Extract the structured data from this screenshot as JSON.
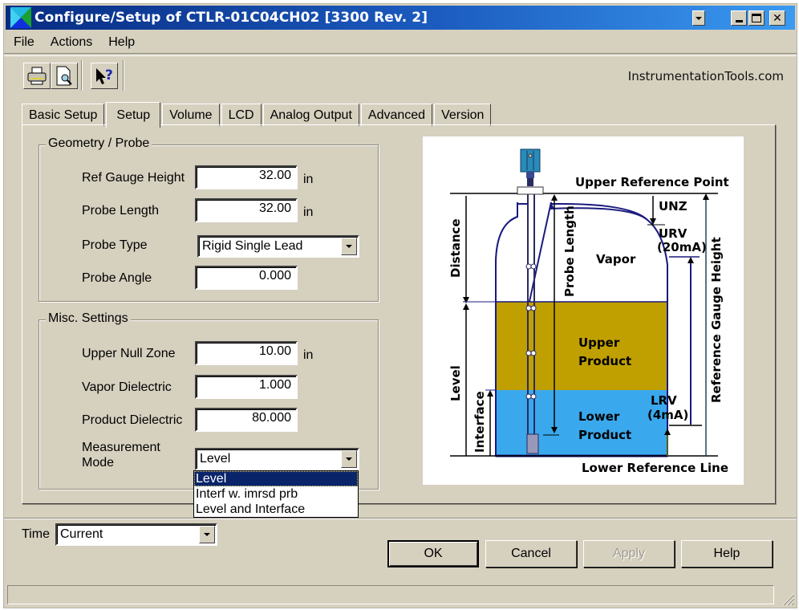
{
  "window": {
    "title": "Configure/Setup of CTLR-01C04CH02 [3300 Rev. 2]",
    "controls": [
      "dropdown",
      "minimize",
      "maximize",
      "close"
    ]
  },
  "menu": {
    "items": [
      {
        "label": "File"
      },
      {
        "label": "Actions"
      },
      {
        "label": "Help"
      }
    ]
  },
  "toolbar": {
    "buttons": [
      {
        "icon": "printer-icon"
      },
      {
        "icon": "print-preview-icon"
      },
      {
        "icon": "context-help-icon"
      }
    ],
    "brand": "InstrumentationTools.com"
  },
  "tabs": [
    {
      "label": "Basic Setup",
      "active": false
    },
    {
      "label": "Setup",
      "active": true
    },
    {
      "label": "Volume",
      "active": false
    },
    {
      "label": "LCD",
      "active": false
    },
    {
      "label": "Analog Output",
      "active": false
    },
    {
      "label": "Advanced",
      "active": false
    },
    {
      "label": "Version",
      "active": false
    }
  ],
  "geometry": {
    "title": "Geometry / Probe",
    "ref_gauge_height": {
      "label": "Ref Gauge Height",
      "value": "32.00",
      "unit": "in"
    },
    "probe_length": {
      "label": "Probe Length",
      "value": "32.00",
      "unit": "in"
    },
    "probe_type": {
      "label": "Probe Type",
      "value": "Rigid Single Lead"
    },
    "probe_angle": {
      "label": "Probe Angle",
      "value": "0.000"
    }
  },
  "misc": {
    "title": "Misc. Settings",
    "upper_null_zone": {
      "label": "Upper Null Zone",
      "value": "10.00",
      "unit": "in"
    },
    "vapor_dielectric": {
      "label": "Vapor Dielectric",
      "value": "1.000"
    },
    "product_dielectric": {
      "label": "Product Dielectric",
      "value": "80.000"
    },
    "measurement_mode": {
      "label_line1": "Measurement",
      "label_line2": "Mode",
      "value": "Level",
      "options": [
        "Level",
        "Interf w. imrsd prb",
        "Level and Interface"
      ],
      "highlighted": "Level"
    }
  },
  "time": {
    "label": "Time",
    "value": "Current"
  },
  "buttons": {
    "ok": "OK",
    "cancel": "Cancel",
    "apply": "Apply",
    "help": "Help"
  },
  "diagram": {
    "labels": {
      "upper_reference_point": "Upper Reference Point",
      "unz": "UNZ",
      "urv": "URV",
      "urv_ma": "(20mA)",
      "vapor": "Vapor",
      "distance": "Distance",
      "probe_length": "Probe Length",
      "upper_product_1": "Upper",
      "upper_product_2": "Product",
      "lower_product_1": "Lower",
      "lower_product_2": "Product",
      "level": "Level",
      "interface": "Interface",
      "lrv": "LRV",
      "lrv_ma": "(4mA)",
      "reference_gauge_height": "Reference Gauge Height",
      "lower_reference_line": "Lower Reference Line"
    },
    "colors": {
      "upper_product": "#c0a000",
      "lower_product": "#3aa8ec",
      "transmitter": "#2a8ab8",
      "tank_outline": "#1a1a80"
    }
  },
  "colors": {
    "titlebar_start": "#082c82",
    "titlebar_end": "#3a9af0",
    "window_bg": "#d6d0bf",
    "selection": "#0a246a"
  }
}
